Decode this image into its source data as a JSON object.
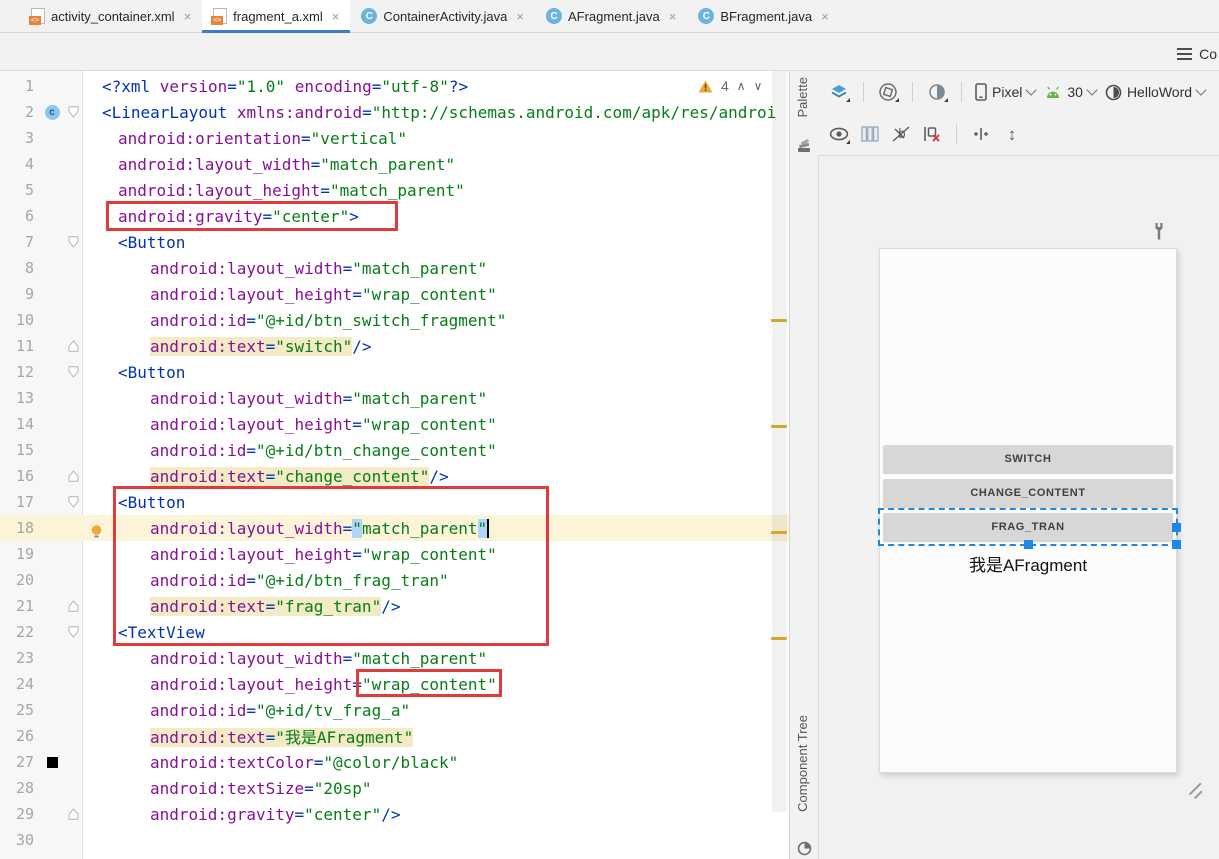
{
  "tabs": [
    {
      "label": "activity_container.xml",
      "icon": "xml-file",
      "active": false,
      "close": "×"
    },
    {
      "label": "fragment_a.xml",
      "icon": "xml-file",
      "active": true,
      "close": "×"
    },
    {
      "label": "ContainerActivity.java",
      "icon": "java-class",
      "active": false,
      "close": "×"
    },
    {
      "label": "AFragment.java",
      "icon": "java-class",
      "active": false,
      "close": "×"
    },
    {
      "label": "BFragment.java",
      "icon": "java-class",
      "active": false,
      "close": "×"
    }
  ],
  "editor": {
    "warning_count": "4",
    "lines": [
      {
        "n": 1,
        "i": 0,
        "t": [
          [
            "g",
            "<?xml "
          ],
          [
            "a",
            "version"
          ],
          [
            "e",
            "="
          ],
          [
            "v",
            "\"1.0\""
          ],
          [
            "p",
            " "
          ],
          [
            "a",
            "encoding"
          ],
          [
            "e",
            "="
          ],
          [
            "v",
            "\"utf-8\""
          ],
          [
            "g",
            "?>"
          ]
        ]
      },
      {
        "n": 2,
        "i": 0,
        "f": "o",
        "g": "c",
        "t": [
          [
            "g",
            "<LinearLayout "
          ],
          [
            "a",
            "xmlns:android"
          ],
          [
            "e",
            "="
          ],
          [
            "v",
            "\"http://schemas.android.com/apk/res/androi"
          ]
        ]
      },
      {
        "n": 3,
        "i": 1,
        "t": [
          [
            "a",
            "android:orientation"
          ],
          [
            "e",
            "="
          ],
          [
            "v",
            "\"vertical\""
          ]
        ]
      },
      {
        "n": 4,
        "i": 1,
        "t": [
          [
            "a",
            "android:layout_width"
          ],
          [
            "e",
            "="
          ],
          [
            "v",
            "\"match_parent\""
          ]
        ]
      },
      {
        "n": 5,
        "i": 1,
        "t": [
          [
            "a",
            "android:layout_height"
          ],
          [
            "e",
            "="
          ],
          [
            "v",
            "\"match_parent\""
          ]
        ]
      },
      {
        "n": 6,
        "i": 1,
        "t": [
          [
            "a",
            "android:gravity"
          ],
          [
            "e",
            "="
          ],
          [
            "v",
            "\"center\""
          ],
          [
            "g",
            ">"
          ]
        ]
      },
      {
        "n": 7,
        "i": 1,
        "f": "o",
        "t": [
          [
            "g",
            "<Button"
          ]
        ]
      },
      {
        "n": 8,
        "i": 3,
        "t": [
          [
            "a",
            "android:layout_width"
          ],
          [
            "e",
            "="
          ],
          [
            "v",
            "\"match_parent\""
          ]
        ]
      },
      {
        "n": 9,
        "i": 3,
        "t": [
          [
            "a",
            "android:layout_height"
          ],
          [
            "e",
            "="
          ],
          [
            "v",
            "\"wrap_content\""
          ]
        ]
      },
      {
        "n": 10,
        "i": 3,
        "t": [
          [
            "a",
            "android:id"
          ],
          [
            "e",
            "="
          ],
          [
            "v",
            "\"@+id/btn_switch_fragment\""
          ]
        ]
      },
      {
        "n": 11,
        "i": 3,
        "f": "c",
        "t": [
          [
            "a",
            "android:text",
            "w"
          ],
          [
            "e",
            "=",
            "w"
          ],
          [
            "v",
            "\"switch\"",
            "w"
          ],
          [
            "g",
            "/>"
          ]
        ]
      },
      {
        "n": 12,
        "i": 1,
        "f": "o",
        "t": [
          [
            "g",
            "<Button"
          ]
        ]
      },
      {
        "n": 13,
        "i": 3,
        "t": [
          [
            "a",
            "android:layout_width"
          ],
          [
            "e",
            "="
          ],
          [
            "v",
            "\"match_parent\""
          ]
        ]
      },
      {
        "n": 14,
        "i": 3,
        "t": [
          [
            "a",
            "android:layout_height"
          ],
          [
            "e",
            "="
          ],
          [
            "v",
            "\"wrap_content\""
          ]
        ]
      },
      {
        "n": 15,
        "i": 3,
        "t": [
          [
            "a",
            "android:id"
          ],
          [
            "e",
            "="
          ],
          [
            "v",
            "\"@+id/btn_change_content\""
          ]
        ]
      },
      {
        "n": 16,
        "i": 3,
        "f": "c",
        "t": [
          [
            "a",
            "android:text",
            "w"
          ],
          [
            "e",
            "=",
            "w"
          ],
          [
            "v",
            "\"change_content\"",
            "w"
          ],
          [
            "g",
            "/>"
          ]
        ]
      },
      {
        "n": 17,
        "i": 1,
        "f": "o",
        "t": [
          [
            "g",
            "<Button"
          ]
        ]
      },
      {
        "n": 18,
        "i": 3,
        "cr": true,
        "g": "b",
        "t": [
          [
            "a",
            "android:layout_width"
          ],
          [
            "e",
            "="
          ],
          [
            "v",
            "\"",
            "s"
          ],
          [
            "v",
            "match_parent"
          ],
          [
            "v",
            "\"",
            "s"
          ],
          [
            "caret",
            ""
          ]
        ]
      },
      {
        "n": 19,
        "i": 3,
        "t": [
          [
            "a",
            "android:layout_height"
          ],
          [
            "e",
            "="
          ],
          [
            "v",
            "\"wrap_content\""
          ]
        ]
      },
      {
        "n": 20,
        "i": 3,
        "t": [
          [
            "a",
            "android:id"
          ],
          [
            "e",
            "="
          ],
          [
            "v",
            "\"@+id/btn_frag_tran\""
          ]
        ]
      },
      {
        "n": 21,
        "i": 3,
        "f": "c",
        "t": [
          [
            "a",
            "android:text",
            "w"
          ],
          [
            "e",
            "=",
            "w"
          ],
          [
            "v",
            "\"frag_tran\"",
            "w"
          ],
          [
            "g",
            "/>"
          ]
        ]
      },
      {
        "n": 22,
        "i": 1,
        "f": "o",
        "t": [
          [
            "g",
            "<TextView"
          ]
        ]
      },
      {
        "n": 23,
        "i": 3,
        "t": [
          [
            "a",
            "android:layout_width"
          ],
          [
            "e",
            "="
          ],
          [
            "v",
            "\"match_parent\""
          ]
        ]
      },
      {
        "n": 24,
        "i": 3,
        "t": [
          [
            "a",
            "android:layout_height"
          ],
          [
            "e",
            "="
          ],
          [
            "v",
            "\"wrap_content\""
          ]
        ]
      },
      {
        "n": 25,
        "i": 3,
        "t": [
          [
            "a",
            "android:id"
          ],
          [
            "e",
            "="
          ],
          [
            "v",
            "\"@+id/tv_frag_a\""
          ]
        ]
      },
      {
        "n": 26,
        "i": 3,
        "t": [
          [
            "a",
            "android:text",
            "w"
          ],
          [
            "e",
            "=",
            "w"
          ],
          [
            "v",
            "\"我是AFragment\"",
            "w"
          ]
        ]
      },
      {
        "n": 27,
        "i": 3,
        "g": "sq",
        "t": [
          [
            "a",
            "android:textColor"
          ],
          [
            "e",
            "="
          ],
          [
            "v",
            "\"@color/black\""
          ]
        ]
      },
      {
        "n": 28,
        "i": 3,
        "t": [
          [
            "a",
            "android:textSize"
          ],
          [
            "e",
            "="
          ],
          [
            "v",
            "\"20sp\""
          ]
        ]
      },
      {
        "n": 29,
        "i": 3,
        "f": "c",
        "t": [
          [
            "a",
            "android:gravity"
          ],
          [
            "e",
            "="
          ],
          [
            "v",
            "\"center\""
          ],
          [
            "g",
            "/>"
          ]
        ]
      },
      {
        "n": 30,
        "i": 0,
        "t": []
      }
    ]
  },
  "panel": {
    "mode_label": "Co",
    "palette_label": "Palette",
    "component_tree_label": "Component Tree",
    "toolbar": {
      "device": "Pixel",
      "api": "30",
      "theme": "HelloWord",
      "row1_icons": [
        "design-surface",
        "orientation",
        "night-mode",
        "device",
        "android-api",
        "theme"
      ],
      "row2_icons": [
        "view-options",
        "columns",
        "design-time-decorations",
        "clear-constraints",
        "infer-constraints",
        "expand-vertical"
      ]
    },
    "preview": {
      "buttons": [
        "SWITCH",
        "CHANGE_CONTENT",
        "FRAG_TRAN"
      ],
      "selected": "FRAG_TRAN",
      "text": "我是AFragment"
    }
  },
  "colors": {
    "accent_blue": "#3d7ecb",
    "selection_blue": "#1e88e5",
    "warning_yellow": "#f2a63a",
    "annotation_red": "#e23b3b",
    "xml_tag": "#0033b3",
    "xml_attr": "#871094",
    "xml_value": "#067d17"
  }
}
